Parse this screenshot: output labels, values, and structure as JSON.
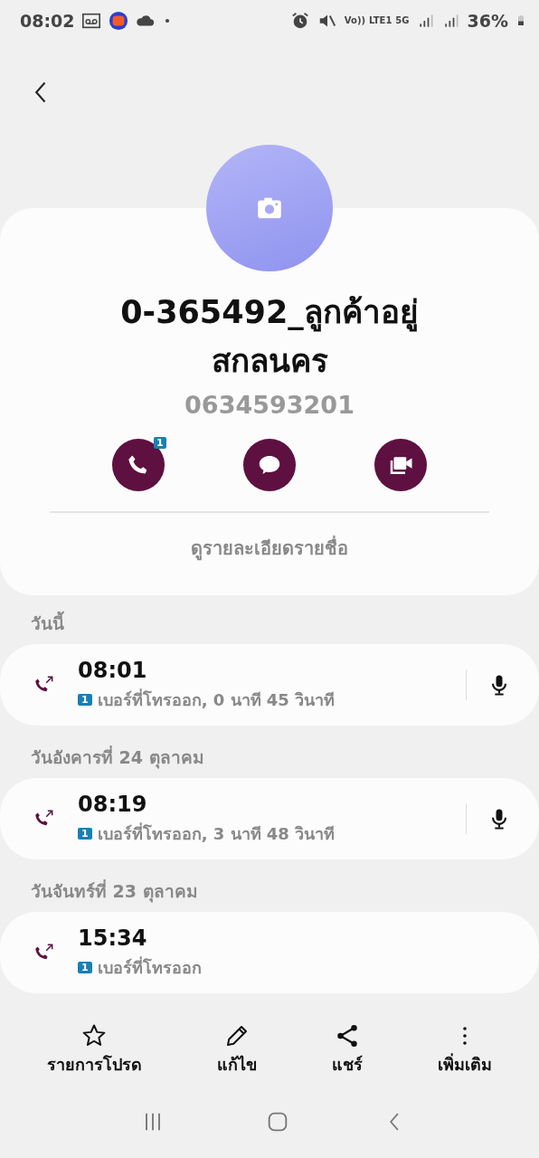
{
  "status_bar": {
    "time": "08:02",
    "network": [
      "Vo))",
      "LTE1",
      "5G"
    ],
    "battery": "36%"
  },
  "contact": {
    "name": "0-365492_ลูกค้าอยู่\nสกลนคร",
    "phone": "0634593201",
    "actions": [
      {
        "kind": "call",
        "badge": "1"
      },
      {
        "kind": "message"
      },
      {
        "kind": "video"
      }
    ],
    "details_link": "ดูรายละเอียดรายชื่อ"
  },
  "history": [
    {
      "date": "วันนี้",
      "calls": [
        {
          "time": "08:01",
          "sim": "1",
          "detail": "เบอร์ที่โทรออก, 0 นาที 45 วินาที",
          "recording": true
        }
      ]
    },
    {
      "date": "วันอังคารที่ 24 ตุลาคม",
      "calls": [
        {
          "time": "08:19",
          "sim": "1",
          "detail": "เบอร์ที่โทรออก, 3 นาที 48 วินาที",
          "recording": true
        }
      ]
    },
    {
      "date": "วันจันทร์ที่ 23 ตุลาคม",
      "calls": [
        {
          "time": "15:34",
          "sim": "1",
          "detail": "เบอร์ที่โทรออก",
          "recording": false
        }
      ]
    }
  ],
  "bottom_actions": [
    {
      "kind": "favorite",
      "label": "รายการโปรด"
    },
    {
      "kind": "edit",
      "label": "แก้ไข"
    },
    {
      "kind": "share",
      "label": "แชร์"
    },
    {
      "kind": "more",
      "label": "เพิ่มเติม"
    }
  ]
}
